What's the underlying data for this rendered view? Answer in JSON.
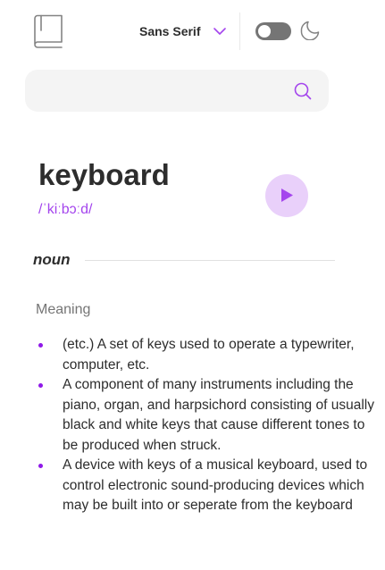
{
  "header": {
    "font_select": {
      "selected": "Sans Serif"
    },
    "theme_toggle": {
      "dark_mode": false
    },
    "icons": {
      "logo": "book-icon",
      "chevron": "chevron-down-icon",
      "moon": "moon-icon"
    }
  },
  "search": {
    "value": "",
    "placeholder": "",
    "icon": "search-icon"
  },
  "entry": {
    "word": "keyboard",
    "phonetic": "/ˈkiːbɔːd/",
    "play_icon": "play-icon",
    "part_of_speech": "noun",
    "meaning_label": "Meaning",
    "definitions": [
      "(etc.) A set of keys used to operate a typewriter, computer, etc.",
      "A component of many instruments including the piano, organ, and harpsichord consisting of usually black and white keys that cause different tones to be produced when struck.",
      "A device with keys of a musical keyboard, used to control electronic sound-producing devices which may be built into or seperate from the keyboard"
    ]
  },
  "colors": {
    "accent": "#a445ed",
    "play_bg": "#e9d0fa",
    "text": "#2d2d2d",
    "muted": "#757575",
    "search_bg": "#f4f4f4"
  }
}
